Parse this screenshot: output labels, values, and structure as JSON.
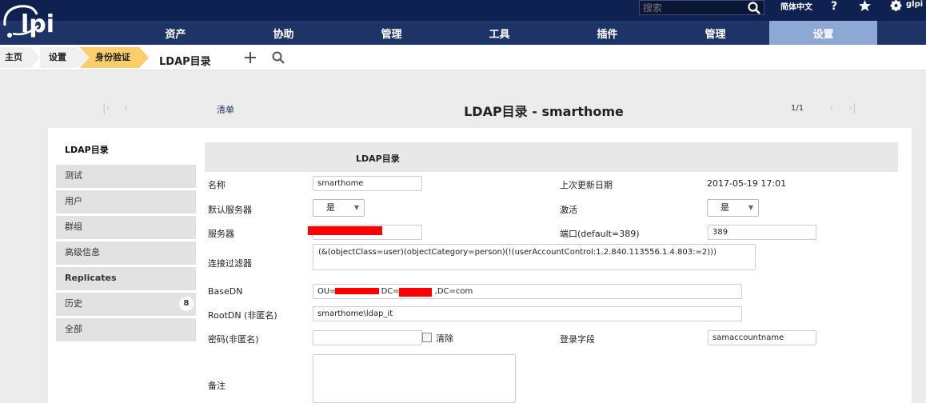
{
  "header": {
    "logo_text": "glpi",
    "search_placeholder": "搜索",
    "language": "简体中文",
    "help_icon": "help-icon",
    "favorites_icon": "star-icon",
    "user_icon": "gear-icon",
    "user_name": "glpi",
    "colors": {
      "top_bar": "#0f2151",
      "menu_bar": "#1e3366",
      "active_menu": "#8ea8d6"
    }
  },
  "menu": {
    "items": [
      {
        "label": "资产"
      },
      {
        "label": "协助"
      },
      {
        "label": "管理"
      },
      {
        "label": "工具"
      },
      {
        "label": "插件"
      },
      {
        "label": "管理"
      },
      {
        "label": "设置",
        "active": true
      }
    ]
  },
  "breadcrumb": {
    "items": [
      "主页",
      "设置",
      "身份验证"
    ],
    "current": "LDAP目录",
    "add_icon": "plus-icon",
    "search_icon": "search-icon",
    "active_color": "#fbcd6b"
  },
  "nav": {
    "list_label": "清单",
    "title": "LDAP目录 - smarthome",
    "pager": "1/1"
  },
  "tabs": [
    {
      "label": "LDAP目录",
      "active": true
    },
    {
      "label": "测试"
    },
    {
      "label": "用户"
    },
    {
      "label": "群组"
    },
    {
      "label": "高级信息"
    },
    {
      "label": "Replicates",
      "bold": true
    },
    {
      "label": "历史",
      "badge": "8"
    },
    {
      "label": "全部"
    }
  ],
  "form": {
    "header": "LDAP目录",
    "name_label": "名称",
    "name_value": "smarthome",
    "last_update_label": "上次更新日期",
    "last_update_value": "2017-05-19 17:01",
    "default_server_label": "默认服务器",
    "default_server_value": "是",
    "active_label": "激活",
    "active_value": "是",
    "server_label": "服务器",
    "port_label": "端口(default=389)",
    "port_value": "389",
    "filter_label": "连接过滤器",
    "filter_value": "(&(objectClass=user)(objectCategory=person)(!(userAccountControl:1.2.840.113556.1.4.803:=2)))",
    "basedn_label": "BaseDN",
    "basedn_prefix": "OU=",
    "basedn_mid": "DC=",
    "basedn_suffix": ",DC=com",
    "rootdn_label": "RootDN (非匿名)",
    "rootdn_value": "smarthome\\ldap_it",
    "password_label": "密码(非匿名)",
    "clear_label": "清除",
    "login_field_label": "登录字段",
    "login_field_value": "samaccountname",
    "comment_label": "备注"
  }
}
